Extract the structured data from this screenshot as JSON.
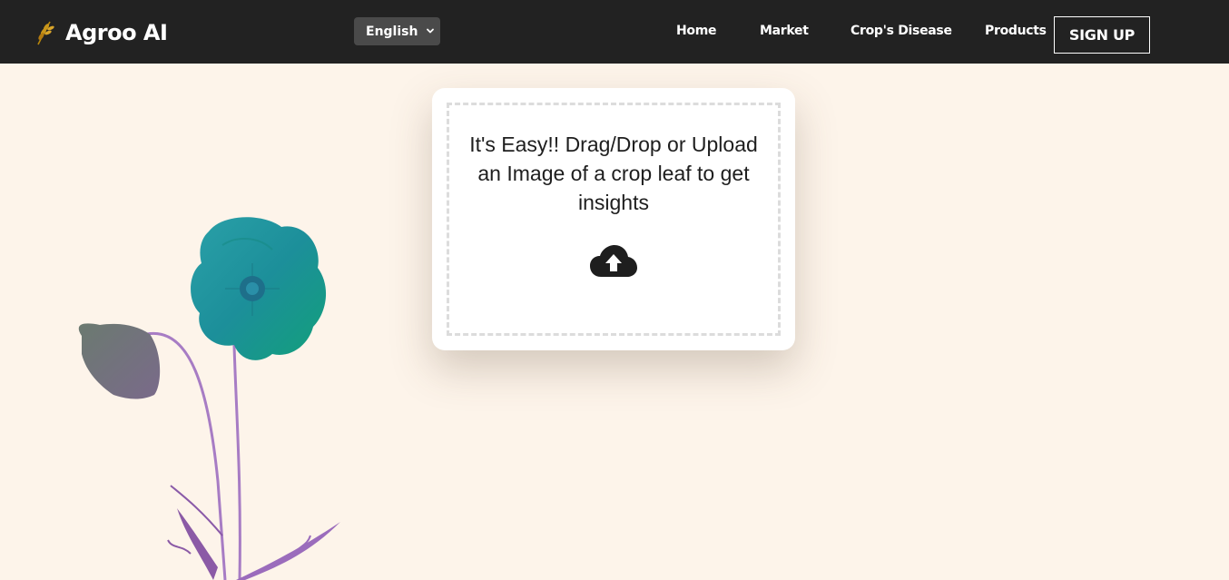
{
  "header": {
    "brand": "Agroo AI",
    "language": "English",
    "nav": [
      {
        "label": "Home"
      },
      {
        "label": "Market"
      },
      {
        "label": "Crop's Disease"
      },
      {
        "label": "Products"
      }
    ],
    "signup_label": "SIGN UP"
  },
  "upload": {
    "instruction": "It's Easy!! Drag/Drop or Upload an Image of a crop leaf to get insights",
    "icon": "cloud-upload-icon"
  },
  "colors": {
    "navbar": "#222222",
    "background": "#fdf4ea",
    "card": "#ffffff",
    "flower_teal": "#1a9e8e",
    "stem_purple": "#a070c0"
  }
}
